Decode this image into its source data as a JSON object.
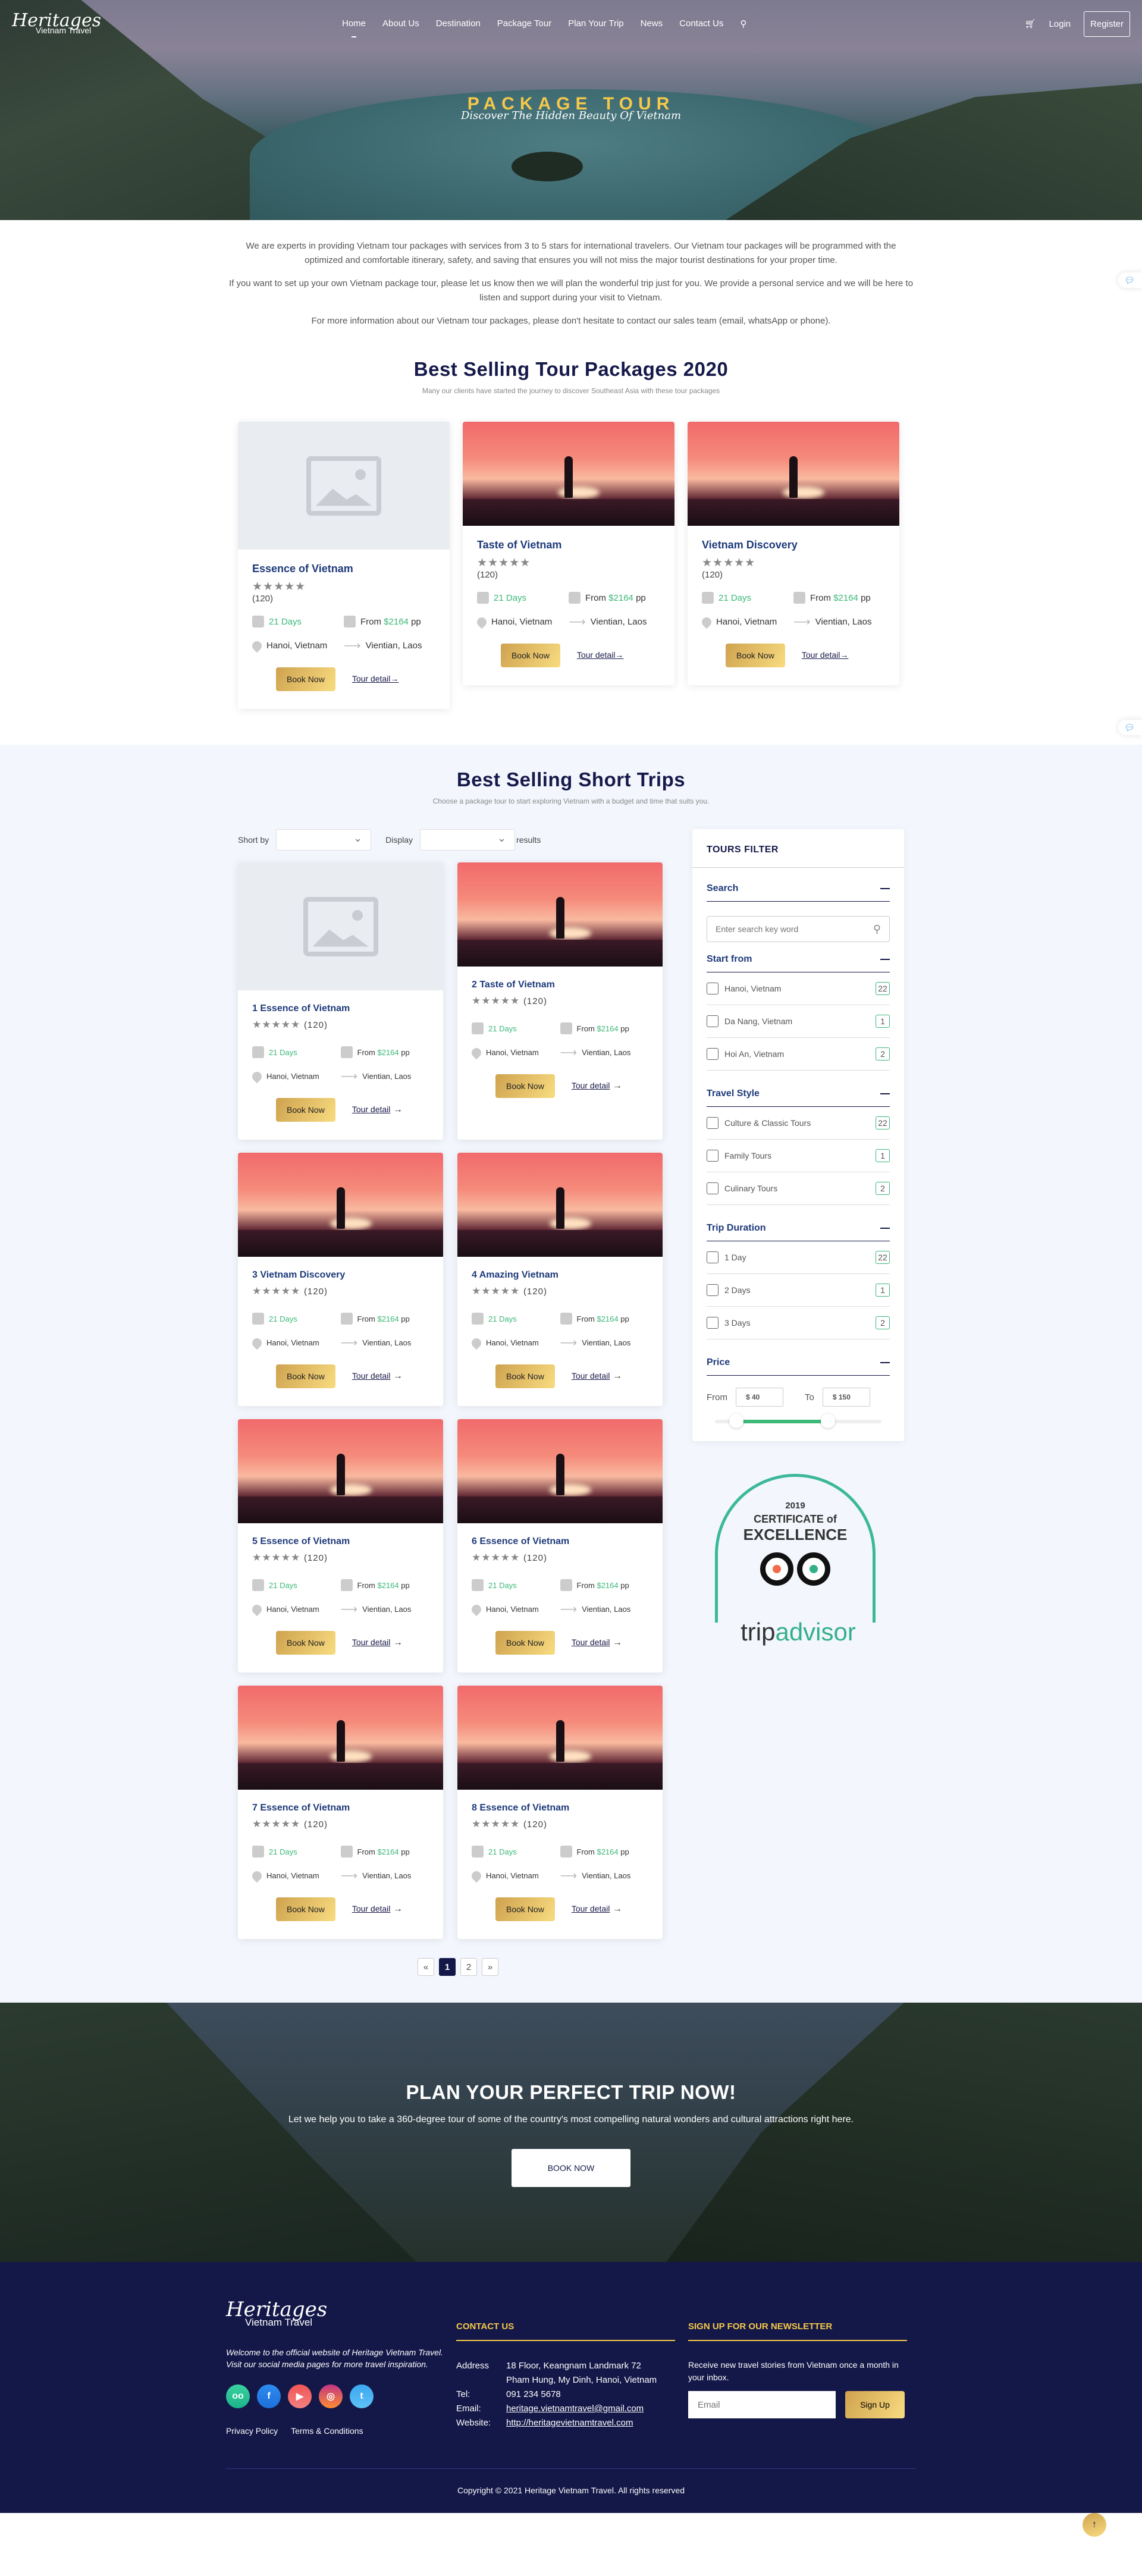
{
  "nav": {
    "logo_script": "Heritages",
    "logo_sub": "Vietnam Travel",
    "items": [
      "Home",
      "About Us",
      "Destination",
      "Package Tour",
      "Plan Your Trip",
      "News",
      "Contact Us"
    ],
    "active": "Home",
    "login": "Login",
    "register": "Register"
  },
  "hero": {
    "title": "PACKAGE TOUR",
    "subtitle": "Discover The Hidden Beauty Of Vietnam"
  },
  "intro": [
    "We are experts in providing Vietnam tour packages with services from 3 to 5 stars for international travelers. Our Vietnam tour packages will be programmed with the optimized and comfortable itinerary, safety, and saving that ensures you will not miss the major tourist destinations for your proper time.",
    "If you want to set up your own Vietnam package tour, please let us know then we will plan the wonderful trip just for you. We provide a personal service and we will be here to listen and support during your visit to Vietnam.",
    "For more information about our Vietnam tour packages, please don't hesitate to contact our sales team (email, whatsApp or phone)."
  ],
  "packages": {
    "title": "Best Selling Tour Packages 2020",
    "subtitle": "Many our clients have started the journey to discover Southeast Asia with these tour packages",
    "items": [
      {
        "title": "Essence of Vietnam",
        "stars": "★★★★★",
        "reviews": "(120)",
        "days": "21 Days",
        "from": "From",
        "price": "$2164",
        "pp": "pp",
        "origin": "Hanoi, Vietnam",
        "dest": "Vientian, Laos",
        "book": "Book Now",
        "detail": "Tour detail→",
        "image": "placeholder"
      },
      {
        "title": "Taste of Vietnam",
        "stars": "★★★★★",
        "reviews": "(120)",
        "days": "21 Days",
        "from": "From",
        "price": "$2164",
        "pp": "pp",
        "origin": "Hanoi, Vietnam",
        "dest": "Vientian, Laos",
        "book": "Book Now",
        "detail": "Tour detail→",
        "image": "sunset"
      },
      {
        "title": "Vietnam Discovery",
        "stars": "★★★★★",
        "reviews": "(120)",
        "days": "21 Days",
        "from": "From",
        "price": "$2164",
        "pp": "pp",
        "origin": "Hanoi, Vietnam",
        "dest": "Vientian, Laos",
        "book": "Book Now",
        "detail": "Tour detail→",
        "image": "sunset"
      }
    ]
  },
  "short_trips": {
    "title": "Best Selling Short Trips",
    "subtitle": "Choose a package tour to start exploring Vietnam with a budget and time that suits you.",
    "sort_label": "Short by",
    "display_label": "Display",
    "results_label": "results",
    "items": [
      {
        "title": "1 Essence of Vietnam",
        "stars": "★★★★★",
        "reviews": "(120)",
        "days": "21 Days",
        "from": "From",
        "price": "$2164",
        "pp": "pp",
        "origin": "Hanoi, Vietnam",
        "dest": "Vientian, Laos",
        "book": "Book Now",
        "detail": "Tour detail",
        "image": "placeholder"
      },
      {
        "title": "2 Taste of Vietnam",
        "stars": "★★★★★",
        "reviews": "(120)",
        "days": "21 Days",
        "from": "From",
        "price": "$2164",
        "pp": "pp",
        "origin": "Hanoi, Vietnam",
        "dest": "Vientian, Laos",
        "book": "Book Now",
        "detail": "Tour detail",
        "image": "sunset"
      },
      {
        "title": "3 Vietnam Discovery",
        "stars": "★★★★★",
        "reviews": "(120)",
        "days": "21 Days",
        "from": "From",
        "price": "$2164",
        "pp": "pp",
        "origin": "Hanoi, Vietnam",
        "dest": "Vientian, Laos",
        "book": "Book Now",
        "detail": "Tour detail",
        "image": "sunset"
      },
      {
        "title": "4 Amazing Vietnam",
        "stars": "★★★★★",
        "reviews": "(120)",
        "days": "21 Days",
        "from": "From",
        "price": "$2164",
        "pp": "pp",
        "origin": "Hanoi, Vietnam",
        "dest": "Vientian, Laos",
        "book": "Book Now",
        "detail": "Tour detail",
        "image": "sunset"
      },
      {
        "title": "5 Essence of Vietnam",
        "stars": "★★★★★",
        "reviews": "(120)",
        "days": "21 Days",
        "from": "From",
        "price": "$2164",
        "pp": "pp",
        "origin": "Hanoi, Vietnam",
        "dest": "Vientian, Laos",
        "book": "Book Now",
        "detail": "Tour detail",
        "image": "sunset"
      },
      {
        "title": "6 Essence of Vietnam",
        "stars": "★★★★★",
        "reviews": "(120)",
        "days": "21 Days",
        "from": "From",
        "price": "$2164",
        "pp": "pp",
        "origin": "Hanoi, Vietnam",
        "dest": "Vientian, Laos",
        "book": "Book Now",
        "detail": "Tour detail",
        "image": "sunset"
      },
      {
        "title": "7 Essence of Vietnam",
        "stars": "★★★★★",
        "reviews": "(120)",
        "days": "21 Days",
        "from": "From",
        "price": "$2164",
        "pp": "pp",
        "origin": "Hanoi, Vietnam",
        "dest": "Vientian, Laos",
        "book": "Book Now",
        "detail": "Tour detail",
        "image": "sunset"
      },
      {
        "title": "8 Essence of Vietnam",
        "stars": "★★★★★",
        "reviews": "(120)",
        "days": "21 Days",
        "from": "From",
        "price": "$2164",
        "pp": "pp",
        "origin": "Hanoi, Vietnam",
        "dest": "Vientian, Laos",
        "book": "Book Now",
        "detail": "Tour detail",
        "image": "sunset"
      }
    ],
    "pagination": {
      "prev": "«",
      "pages": [
        "1",
        "2"
      ],
      "current": "1",
      "next": "»"
    }
  },
  "filter": {
    "title": "TOURS FILTER",
    "search": {
      "label": "Search",
      "placeholder": "Enter search key word"
    },
    "groups": [
      {
        "label": "Start from",
        "options": [
          {
            "label": "Hanoi, Vietnam",
            "count": "22"
          },
          {
            "label": "Da Nang, Vietnam",
            "count": "1"
          },
          {
            "label": "Hoi An, Vietnam",
            "count": "2"
          }
        ]
      },
      {
        "label": "Travel Style",
        "options": [
          {
            "label": "Culture & Classic Tours",
            "count": "22"
          },
          {
            "label": "Family Tours",
            "count": "1"
          },
          {
            "label": "Culinary Tours",
            "count": "2"
          }
        ]
      },
      {
        "label": "Trip Duration",
        "options": [
          {
            "label": "1 Day",
            "count": "22"
          },
          {
            "label": "2 Days",
            "count": "1"
          },
          {
            "label": "3 Days",
            "count": "2"
          }
        ]
      }
    ],
    "price": {
      "label": "Price",
      "from_label": "From",
      "from_value": "$ 40",
      "to_label": "To",
      "to_value": "$ 150",
      "range_low_pct": 13,
      "range_high_pct": 68
    }
  },
  "tripadvisor": {
    "year": "2019",
    "cert": "CERTIFICATE of",
    "excellence": "EXCELLENCE",
    "brand_trip": "trip",
    "brand_advisor": "advisor"
  },
  "cta": {
    "title": "PLAN YOUR PERFECT TRIP NOW!",
    "text": "Let we help you to take a 360-degree tour of some of the country's most compelling natural wonders and cultural attractions right here.",
    "button": "BOOK NOW"
  },
  "footer": {
    "logo_script": "Heritages",
    "logo_sub": "Vietnam Travel",
    "welcome": "Welcome to the official website of Heritage Vietnam Travel. Visit our social media pages for more travel inspiration.",
    "socials": [
      "tripadvisor",
      "facebook",
      "youtube",
      "instagram",
      "twitter"
    ],
    "links": [
      "Privacy Policy",
      "Terms & Conditions"
    ],
    "contact_title": "CONTACT US",
    "address_label": "Address",
    "address_1": "18 Floor, Keangnam Landmark 72",
    "address_2": "Pham Hung, My Dinh, Hanoi, Vietnam",
    "tel_label": "Tel:",
    "tel": "091 234 5678",
    "email_label": "Email:",
    "email": "heritage.vietnamtravel@gmail.com",
    "website_label": "Website:",
    "website": "http://heritagevietnamtravel.com",
    "newsletter_title": "SIGN UP FOR OUR NEWSLETTER",
    "newsletter_text": "Receive new travel stories from Vietnam once a month in your inbox.",
    "email_placeholder": "Email",
    "signup": "Sign Up",
    "copyright": "Copyright © 2021 Heritage Vietnam Travel. All rights reserved"
  },
  "colors": {
    "navy": "#141848",
    "gold": "#f5c84a",
    "green": "#3cb878",
    "title_blue": "#1e3a7a"
  }
}
